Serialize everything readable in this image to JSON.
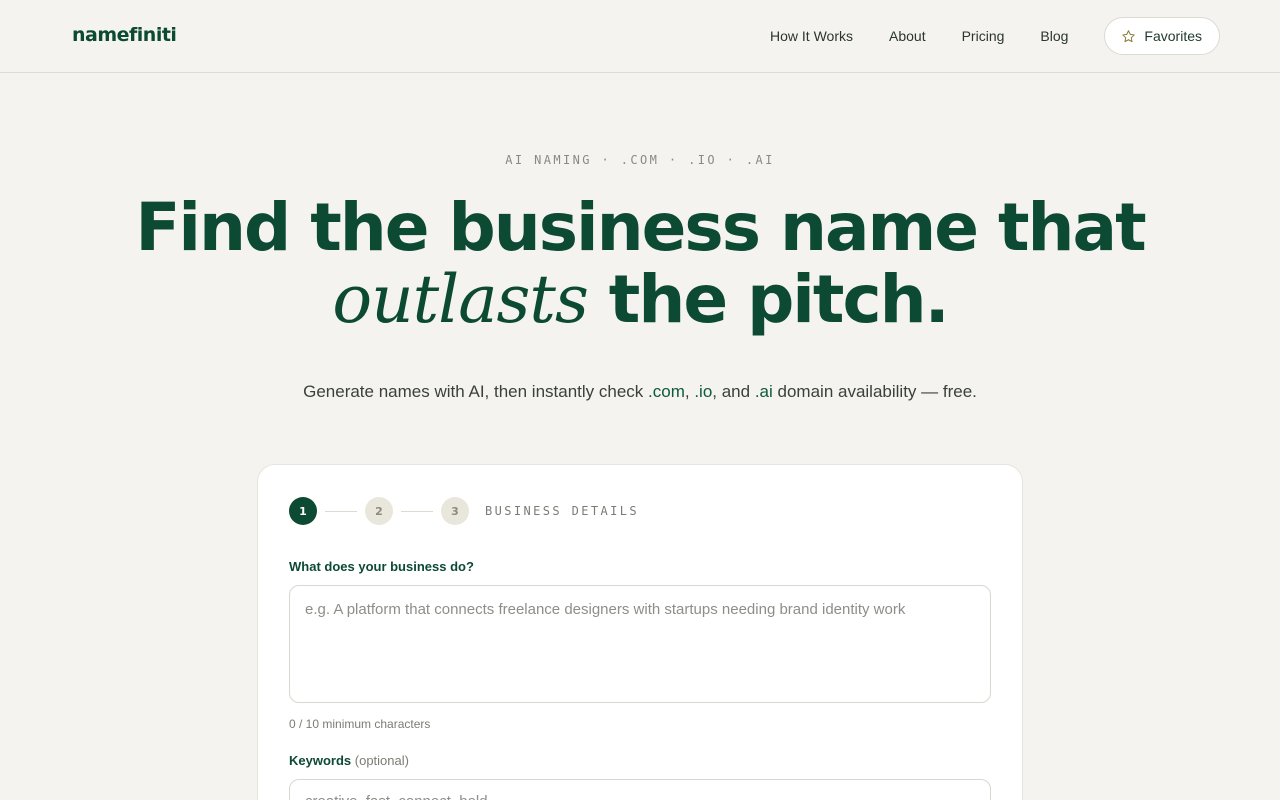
{
  "header": {
    "logo": "namefiniti",
    "nav": [
      "How It Works",
      "About",
      "Pricing",
      "Blog"
    ],
    "favorites_label": "Favorites"
  },
  "hero": {
    "eyebrow": "AI NAMING · .COM · .IO · .AI",
    "headline_line1": "Find the business name that",
    "headline_em": "outlasts",
    "headline_rest": " the pitch.",
    "sub_prefix": "Generate names with AI, then instantly check ",
    "tld1": ".com",
    "sep1": ", ",
    "tld2": ".io",
    "sep2": ", and ",
    "tld3": ".ai",
    "sub_suffix": " domain availability — free."
  },
  "form": {
    "steps": [
      "1",
      "2",
      "3"
    ],
    "current_step": 1,
    "step_label": "BUSINESS DETAILS",
    "business_label": "What does your business do?",
    "business_value": "",
    "business_placeholder": "e.g. A platform that connects freelance designers with startups needing brand identity work",
    "counter": "0 / 10 minimum characters",
    "keywords_label": "Keywords",
    "keywords_optional": "(optional)",
    "keywords_value": "",
    "keywords_placeholder": "creative, fast, connect, bold"
  },
  "colors": {
    "brand": "#0d4a33",
    "background": "#f4f3ef",
    "card": "#ffffff"
  },
  "icons": {
    "favorites": "star-icon"
  }
}
